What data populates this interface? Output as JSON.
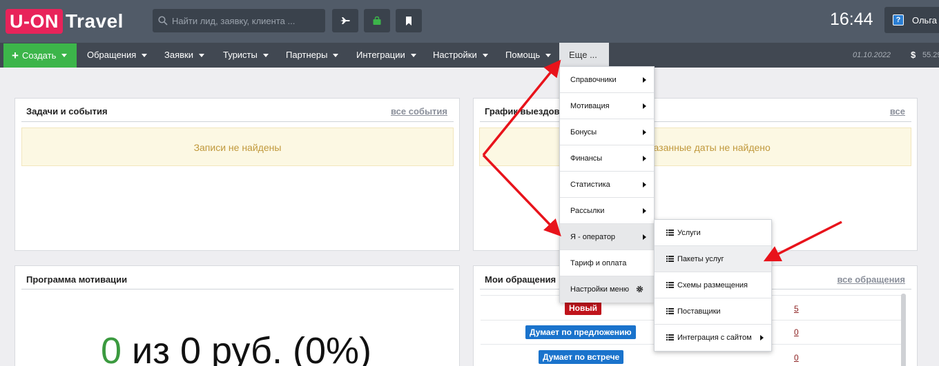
{
  "header": {
    "logo_box": "U-ON",
    "logo_text": "Travel",
    "search_placeholder": "Найти лид, заявку, клиента ...",
    "clock": "16:44",
    "user_name": "Ольга",
    "help_icon_text": "?"
  },
  "nav": {
    "create_label": "Создать",
    "items": [
      "Обращения",
      "Заявки",
      "Туристы",
      "Партнеры",
      "Интеграции",
      "Настройки",
      "Помощь"
    ],
    "more_label": "Еще ...",
    "date": "01.10.2022",
    "currency_symbol": "$",
    "rate": "55.29"
  },
  "panels": {
    "tasks": {
      "title": "Задачи и события",
      "link": "все события",
      "notice": "Записи не найдены"
    },
    "schedule": {
      "title": "График выездов",
      "link": "все",
      "notice": "... на указанные даты не найдено"
    },
    "motivation": {
      "title": "Программа мотивации",
      "zero": "0",
      "text": " из 0 руб. (0%)"
    },
    "requests": {
      "title": "Мои обращения",
      "link": "все обращения",
      "rows": [
        {
          "label": "Новый",
          "count": "5",
          "color": "#c0141c"
        },
        {
          "label": "Думает по предложению",
          "count": "0",
          "color": "#1a73cc"
        },
        {
          "label": "Думает по встрече",
          "count": "0",
          "color": "#1a73cc"
        }
      ]
    }
  },
  "dropdown": {
    "items": [
      {
        "label": "Справочники",
        "has_submenu": true
      },
      {
        "label": "Мотивация",
        "has_submenu": true
      },
      {
        "label": "Бонусы",
        "has_submenu": true
      },
      {
        "label": "Финансы",
        "has_submenu": true
      },
      {
        "label": "Статистика",
        "has_submenu": true
      },
      {
        "label": "Рассылки",
        "has_submenu": true
      },
      {
        "label": "Я - оператор",
        "has_submenu": true
      },
      {
        "label": "Тариф и оплата",
        "has_submenu": false
      },
      {
        "label": "Настройки меню",
        "has_submenu": false,
        "icon": "gear-icon"
      }
    ],
    "submenu": [
      {
        "label": "Услуги"
      },
      {
        "label": "Пакеты услуг"
      },
      {
        "label": "Схемы размещения"
      },
      {
        "label": "Поставщики"
      },
      {
        "label": "Интеграция с сайтом",
        "has_submenu": true
      }
    ]
  },
  "colors": {
    "topbar": "#515b68",
    "navbar": "#414852",
    "create_button": "#3cb54a",
    "logo_accent": "#e8235a",
    "annotation_arrow": "#e8131b"
  },
  "icons": [
    "search-icon",
    "plane-icon",
    "bag-icon",
    "bookmark-icon",
    "help-icon",
    "plus-icon",
    "gear-icon",
    "list-icon"
  ]
}
